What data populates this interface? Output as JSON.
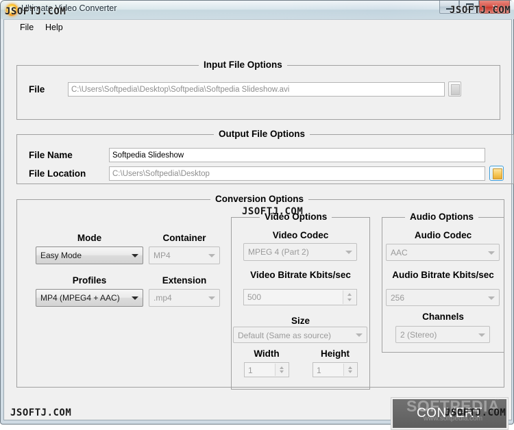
{
  "window": {
    "title": "Ultimate Video Converter",
    "icon": "sun-app-icon",
    "buttons": {
      "minimize": "minimize-icon",
      "maximize": "maximize-icon",
      "close": "×"
    }
  },
  "menubar": {
    "items": [
      {
        "label": "File"
      },
      {
        "label": "Help"
      }
    ]
  },
  "input_file_options": {
    "title": "Input File Options",
    "file_label": "File",
    "file_value": "C:\\Users\\Softpedia\\Desktop\\Softpedia\\Softpedia Slideshow.avi",
    "browse_icon": "browse-square-icon"
  },
  "output_file_options": {
    "title": "Output File Options",
    "file_name_label": "File Name",
    "file_name_value": "Softpedia Slideshow",
    "file_location_label": "File Location",
    "file_location_value": "C:\\Users\\Softpedia\\Desktop",
    "browse_icon": "folder-icon"
  },
  "conversion_options": {
    "title": "Conversion Options",
    "mode_label": "Mode",
    "mode_value": "Easy Mode",
    "container_label": "Container",
    "container_value": "MP4",
    "profiles_label": "Profiles",
    "profiles_value": "MP4 (MPEG4 + AAC)",
    "extension_label": "Extension",
    "extension_value": ".mp4"
  },
  "video_options": {
    "title": "Video Options",
    "codec_label": "Video Codec",
    "codec_value": "MPEG 4 (Part 2)",
    "bitrate_label": "Video Bitrate Kbits/sec",
    "bitrate_value": "500",
    "size_label": "Size",
    "size_value": "Default (Same as source)",
    "width_label": "Width",
    "width_value": "1",
    "height_label": "Height",
    "height_value": "1"
  },
  "audio_options": {
    "title": "Audio Options",
    "codec_label": "Audio Codec",
    "codec_value": "AAC",
    "bitrate_label": "Audio Bitrate Kbits/sec",
    "bitrate_value": "256",
    "channels_label": "Channels",
    "channels_value": "2 (Stereo)"
  },
  "convert": {
    "label": "CONVERT"
  },
  "watermarks": {
    "jsoftj": "JSOFTJ.COM",
    "softpedia_word": "SOFTPEDIA",
    "softpedia_tm": "™",
    "softpedia_url": "www.softpedia.com"
  },
  "colors": {
    "close_button": "#c8372c",
    "convert_button": "#686868",
    "folder_icon": "#f6c758",
    "window_background": "#f0f0f0"
  }
}
